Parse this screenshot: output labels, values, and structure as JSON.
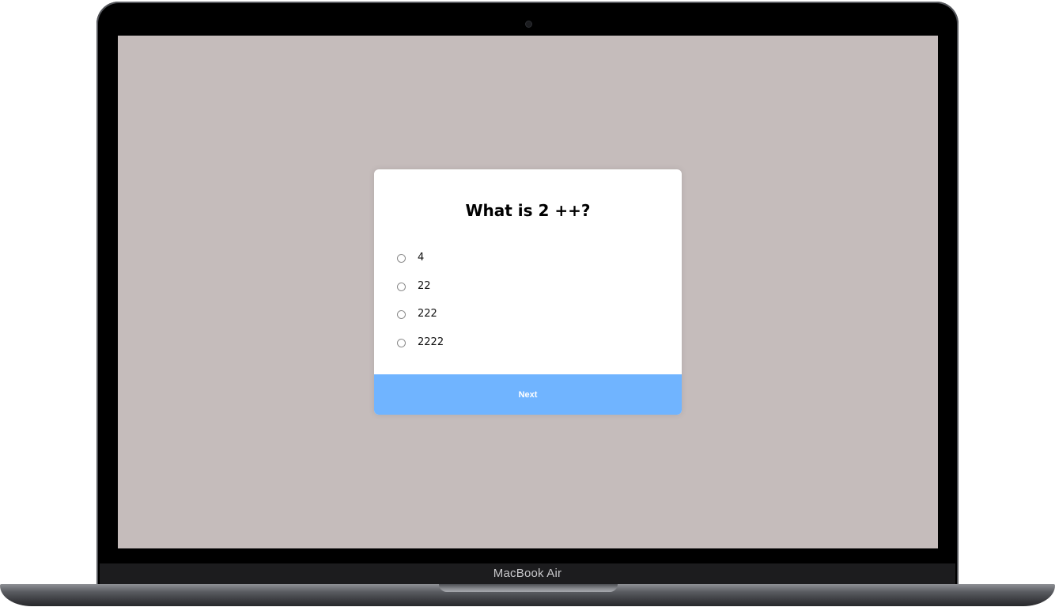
{
  "device": {
    "brand_label": "MacBook Air"
  },
  "quiz": {
    "question": "What is 2 ++?",
    "answers": [
      {
        "label": "4",
        "selected": false
      },
      {
        "label": "22",
        "selected": false
      },
      {
        "label": "222",
        "selected": false
      },
      {
        "label": "2222",
        "selected": false
      }
    ],
    "next_label": "Next"
  },
  "colors": {
    "screen_background": "#c5bcbb",
    "card_background": "#ffffff",
    "button_background": "#70b4ff",
    "button_text": "#ffffff"
  }
}
